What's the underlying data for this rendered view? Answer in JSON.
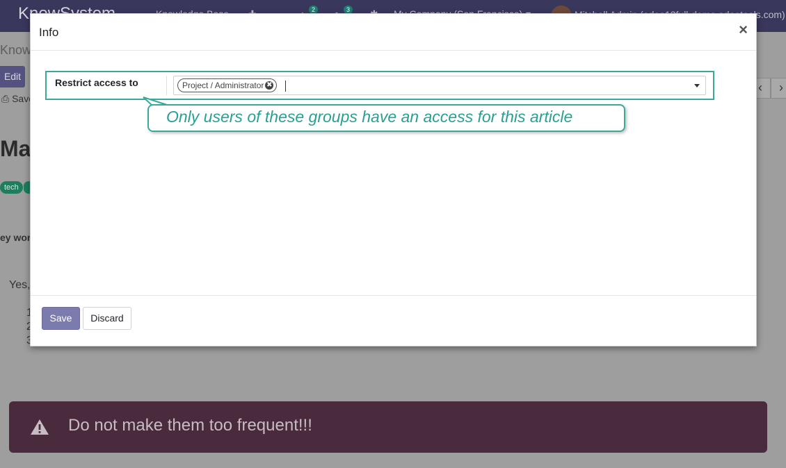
{
  "navbar": {
    "brand": "KnowSystem",
    "menu_knowledge_base": "Knowledge Base",
    "activity_count": "2",
    "messages_count": "3",
    "company": "My Company (San Francisco)",
    "user": "Mitchell Admin (odoo12full-demo.odootools.com)"
  },
  "background": {
    "breadcrumb": "KnowS",
    "edit_label": "Edit",
    "save_label": "Save",
    "title": "May",
    "tag_1": "tech",
    "keywords_label": "ey wor",
    "answer_start": "Yes,",
    "list_numbers": [
      "1",
      "2",
      "3"
    ],
    "alert_text": "Do not make them too frequent!!!",
    "colors": {
      "alert_bg": "#4a2a3d",
      "navbar_bg": "#39375c"
    }
  },
  "modal": {
    "title": "Info",
    "close_symbol": "×",
    "field_label": "Restrict access to",
    "selected_tag": "Project / Administrator",
    "tag_remove_symbol": "✖",
    "callout_text": "Only users of these groups have an access for this article",
    "save_label": "Save",
    "discard_label": "Discard",
    "colors": {
      "highlight": "#3aa99a",
      "primary_button": "#7c7bad"
    }
  }
}
